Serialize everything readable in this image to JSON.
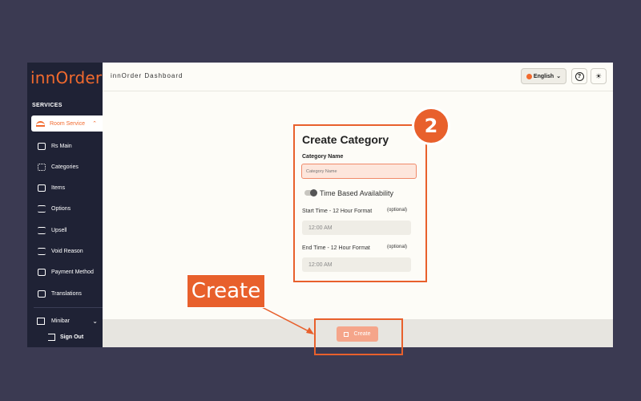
{
  "sidebar": {
    "logo": "innOrder",
    "section_label": "SERVICES",
    "active_item": "Room Service",
    "items": [
      {
        "label": "Rs Main",
        "icon": "people-icon"
      },
      {
        "label": "Categories",
        "icon": "grid-icon"
      },
      {
        "label": "Items",
        "icon": "book-icon"
      },
      {
        "label": "Options",
        "icon": "sliders-icon"
      },
      {
        "label": "Upsell",
        "icon": "upsell-icon"
      },
      {
        "label": "Void Reason",
        "icon": "void-icon"
      },
      {
        "label": "Payment Method",
        "icon": "payment-icon"
      },
      {
        "label": "Translations",
        "icon": "translate-icon"
      }
    ],
    "minibar": "Minibar",
    "sign_out": "Sign Out"
  },
  "header": {
    "title": "innOrder Dashboard",
    "language": "English",
    "help": "?",
    "theme": "☀"
  },
  "form": {
    "title": "Create Category",
    "name_label": "Category Name",
    "name_placeholder": "Category Name",
    "toggle_label": "Time Based Availability",
    "start_label": "Start Time - 12 Hour Format",
    "start_optional": "(optional)",
    "start_value": "12:00 AM",
    "end_label": "End Time - 12 Hour Format",
    "end_optional": "(optional)",
    "end_value": "12:00 AM"
  },
  "footer": {
    "create_label": "Create"
  },
  "annotations": {
    "step": "2",
    "callout": "Create"
  },
  "colors": {
    "accent": "#e8602c",
    "sidebar": "#1f2235",
    "background": "#3b3a52"
  }
}
